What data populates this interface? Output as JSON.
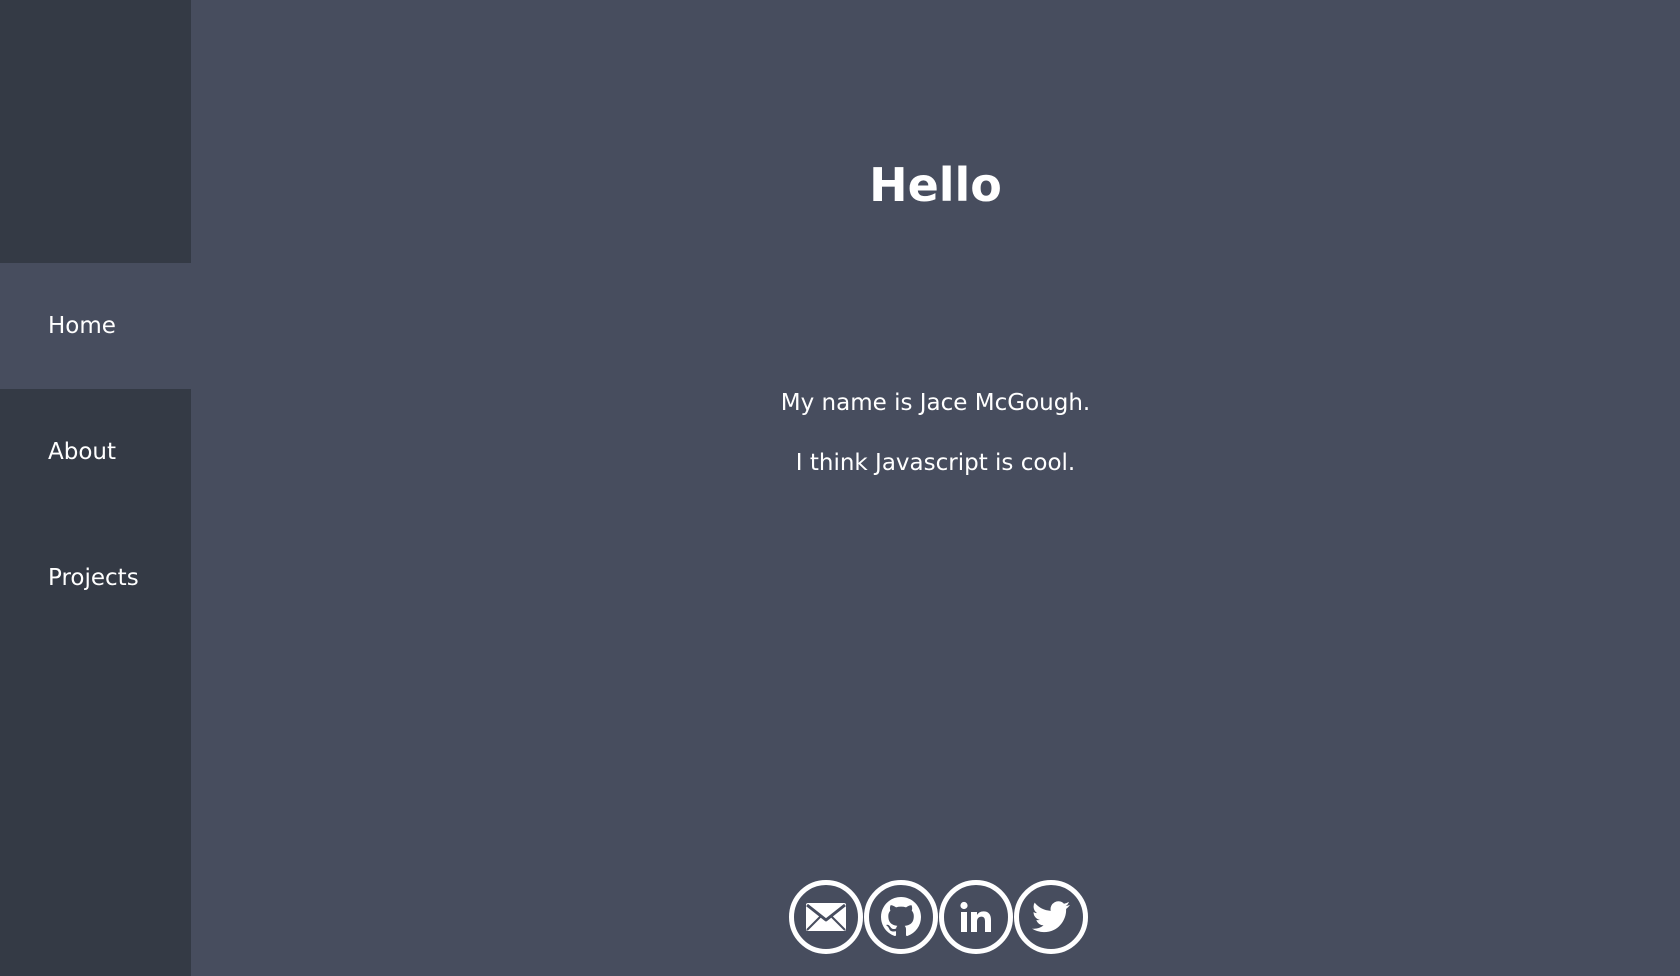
{
  "sidebar": {
    "items": [
      {
        "label": "Home",
        "active": true
      },
      {
        "label": "About",
        "active": false
      },
      {
        "label": "Projects",
        "active": false
      }
    ]
  },
  "main": {
    "title": "Hello",
    "intro": [
      "My name is Jace McGough.",
      "I think Javascript is cool."
    ]
  },
  "social": [
    {
      "icon": "mail-icon"
    },
    {
      "icon": "github-icon"
    },
    {
      "icon": "linkedin-icon"
    },
    {
      "icon": "twitter-icon"
    }
  ],
  "colors": {
    "sidebar_bg": "#343a45",
    "main_bg": "#474d5e",
    "active_bg": "#474d5e",
    "text": "#ffffff"
  }
}
